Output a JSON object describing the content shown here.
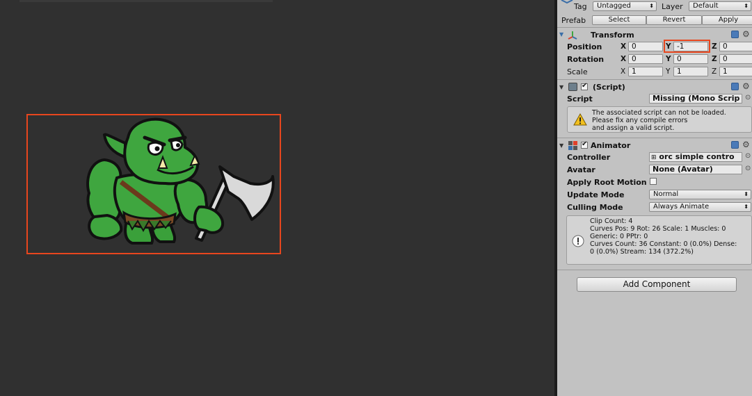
{
  "header": {
    "tag_label": "Tag",
    "tag_value": "Untagged",
    "layer_label": "Layer",
    "layer_value": "Default",
    "prefab_label": "Prefab",
    "select_label": "Select",
    "revert_label": "Revert",
    "apply_label": "Apply"
  },
  "transform": {
    "title": "Transform",
    "position_label": "Position",
    "rotation_label": "Rotation",
    "scale_label": "Scale",
    "x_label": "X",
    "y_label": "Y",
    "z_label": "Z",
    "position": {
      "x": "0",
      "y": "-1",
      "z": "0"
    },
    "rotation": {
      "x": "0",
      "y": "0",
      "z": "0"
    },
    "scale": {
      "x": "1",
      "y": "1",
      "z": "1"
    }
  },
  "script_component": {
    "title": "(Script)",
    "script_label": "Script",
    "script_value": "Missing (Mono Scrip",
    "warning_line1": "The associated script can not be loaded.",
    "warning_line2": "Please fix any compile errors",
    "warning_line3": "and assign a valid script."
  },
  "animator": {
    "title": "Animator",
    "controller_label": "Controller",
    "controller_value": "orc simple contro",
    "avatar_label": "Avatar",
    "avatar_value": "None (Avatar)",
    "root_motion_label": "Apply Root Motion",
    "update_mode_label": "Update Mode",
    "update_mode_value": "Normal",
    "culling_mode_label": "Culling Mode",
    "culling_mode_value": "Always Animate",
    "info_line1": "Clip Count: 4",
    "info_line2": "Curves Pos: 9 Rot: 26 Scale: 1 Muscles: 0",
    "info_line3": "Generic: 0 PPtr: 0",
    "info_line4": "Curves Count: 36 Constant: 0 (0.0%) Dense:",
    "info_line5": "0 (0.0%) Stream: 134 (372.2%)"
  },
  "add_component_label": "Add Component",
  "colors": {
    "highlight": "#e8461e",
    "scene_bg": "#303030",
    "inspector_bg": "#c2c2c2",
    "orc_green": "#3fa63f"
  }
}
